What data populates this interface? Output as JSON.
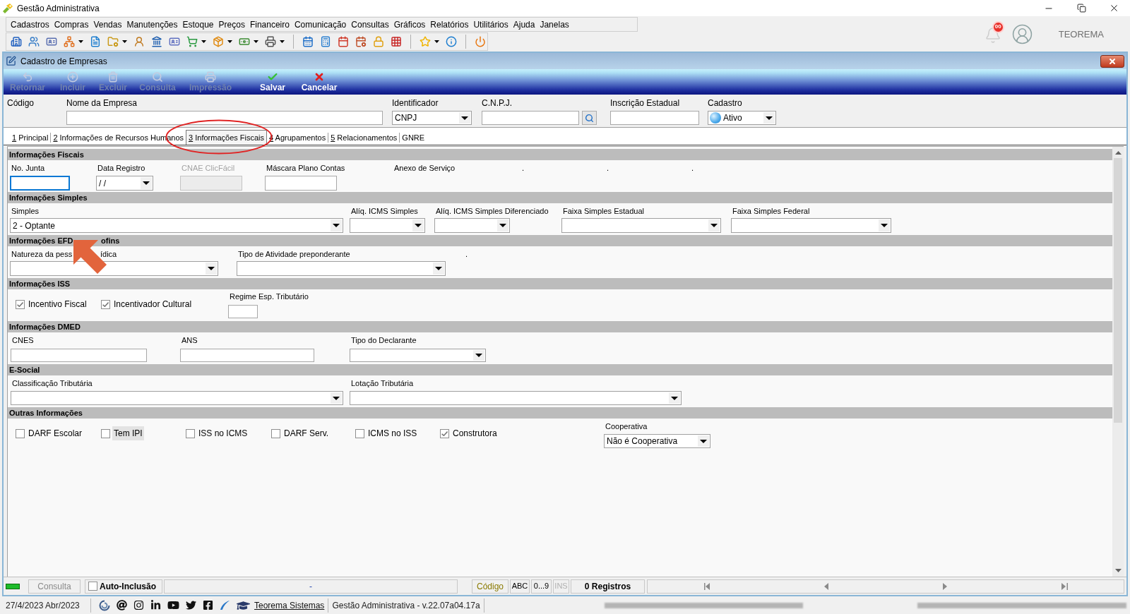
{
  "app": {
    "title": "Gestão Administrativa",
    "notification_count": "00",
    "user": "TEOREMA"
  },
  "menu": [
    "Cadastros",
    "Compras",
    "Vendas",
    "Manutenções",
    "Estoque",
    "Preços",
    "Financeiro",
    "Comunicação",
    "Consultas",
    "Gráficos",
    "Relatórios",
    "Utilitários",
    "Ajuda",
    "Janelas"
  ],
  "window": {
    "title": "Cadastro de Empresas"
  },
  "actions": [
    {
      "kind": "back",
      "label": "Retornar",
      "disabled": true
    },
    {
      "kind": "add",
      "label": "Incluir",
      "disabled": true
    },
    {
      "kind": "delete",
      "label": "Excluir",
      "disabled": true
    },
    {
      "kind": "search",
      "label": "Consulta",
      "disabled": true
    },
    {
      "kind": "print",
      "label": "Impressão",
      "disabled": true
    },
    {
      "kind": "save",
      "label": "Salvar",
      "disabled": false
    },
    {
      "kind": "cancel",
      "label": "Cancelar",
      "disabled": false
    }
  ],
  "header_fields": [
    {
      "kind": "label",
      "label": "Código"
    },
    {
      "kind": "text",
      "label": "Nome da Empresa"
    },
    {
      "kind": "select",
      "label": "Identificador",
      "value": "CNPJ"
    },
    {
      "kind": "lookup",
      "label": "C.N.P.J."
    },
    {
      "kind": "text",
      "label": "Inscrição Estadual"
    },
    {
      "kind": "status",
      "label": "Cadastro",
      "value": "Ativo"
    }
  ],
  "tabs": [
    {
      "number": "1",
      "label": "Principal",
      "selected": false
    },
    {
      "number": "2",
      "label": "Informações de Recursos Humanos",
      "selected": false
    },
    {
      "number": "3",
      "label": "Informações Fiscais",
      "selected": true
    },
    {
      "number": "4",
      "label": "Agrupamentos",
      "selected": false
    },
    {
      "number": "5",
      "label": "Relacionamentos",
      "selected": false
    },
    {
      "label": "GNRE",
      "selected": false
    }
  ],
  "sections": [
    {
      "title": "Informações Fiscais",
      "fields": [
        {
          "kind": "text",
          "label": "No. Junta",
          "focused": true,
          "disabled": false
        },
        {
          "kind": "select",
          "label": "Data Registro",
          "value": "/ /",
          "focused": false,
          "disabled": false
        },
        {
          "kind": "text",
          "label": "CNAE ClicFácil",
          "focused": false,
          "disabled": true
        },
        {
          "kind": "text",
          "label": "Máscara Plano Contas",
          "focused": false,
          "disabled": false
        },
        {
          "kind": "label",
          "label": "Anexo de Serviço"
        },
        {
          "kind": "label",
          "label": "."
        },
        {
          "kind": "label",
          "label": "."
        },
        {
          "kind": "label",
          "label": "."
        }
      ]
    },
    {
      "title": "Informações Simples",
      "fields": [
        {
          "kind": "select",
          "label": "Simples",
          "value": "2 - Optante"
        },
        {
          "kind": "select",
          "label": "Alíq. ICMS Simples"
        },
        {
          "kind": "select",
          "label": "Alíq. ICMS Simples Diferenciado"
        },
        {
          "kind": "select",
          "label": "Faixa Simples Estadual"
        },
        {
          "kind": "select",
          "label": "Faixa Simples Federal"
        }
      ]
    },
    {
      "title_parts": [
        "Informações EFD",
        "ofins"
      ],
      "fields": [
        {
          "kind": "select",
          "label_parts": [
            "Natureza da pess",
            "ídica"
          ]
        },
        {
          "kind": "select",
          "label": "Tipo de Atividade preponderante"
        },
        {
          "kind": "label",
          "label": "."
        }
      ]
    },
    {
      "title": "Informações ISS",
      "fields": [
        {
          "kind": "checkbox",
          "label": "Incentivo Fiscal",
          "checked": true
        },
        {
          "kind": "checkbox",
          "label": "Incentivador Cultural",
          "checked": true
        },
        {
          "kind": "text",
          "label": "Regime Esp. Tributário"
        }
      ]
    },
    {
      "title": "Informações DMED",
      "fields": [
        {
          "kind": "text",
          "label": "CNES"
        },
        {
          "kind": "text",
          "label": "ANS"
        },
        {
          "kind": "select",
          "label": "Tipo do Declarante"
        }
      ]
    },
    {
      "title": "E-Social",
      "fields": [
        {
          "kind": "select",
          "label": "Classificação Tributária"
        },
        {
          "kind": "select",
          "label": "Lotação Tributária"
        }
      ]
    },
    {
      "title": "Outras Informações",
      "fields": [
        {
          "kind": "checkbox",
          "label": "DARF Escolar",
          "checked": false,
          "highlighted": false
        },
        {
          "kind": "checkbox",
          "label": "Tem IPI",
          "checked": false,
          "highlighted": true
        },
        {
          "kind": "checkbox",
          "label": "ISS no ICMS",
          "checked": false,
          "highlighted": false
        },
        {
          "kind": "checkbox",
          "label": "DARF Serv.",
          "checked": false,
          "highlighted": false
        },
        {
          "kind": "checkbox",
          "label": "ICMS no ISS",
          "checked": false,
          "highlighted": false
        },
        {
          "kind": "checkbox",
          "label": "Construtora",
          "checked": true,
          "highlighted": false
        },
        {
          "kind": "select",
          "label": "Cooperativa",
          "value": "Não é Cooperativa"
        }
      ]
    }
  ],
  "status_bar": {
    "mode": "Consulta",
    "auto_include": {
      "label": "Auto-Inclusão",
      "checked": false
    },
    "message": "-",
    "search_key": "Código",
    "indicators": [
      {
        "label": "ABC",
        "disabled": false
      },
      {
        "label": "0...9",
        "disabled": false
      },
      {
        "label": "INS",
        "disabled": true
      }
    ],
    "records": "0 Registros"
  },
  "footer": {
    "date": "27/4/2023 Abr/2023",
    "link": "Teorema Sistemas",
    "version": "Gestão Administrativa - v.22.07a04.17a"
  }
}
